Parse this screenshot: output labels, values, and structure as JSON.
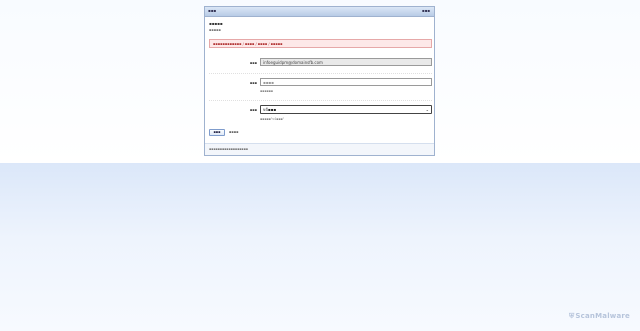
{
  "header": {
    "title": "▪▪▪",
    "right_text": "▪▪▪"
  },
  "form": {
    "heading": "▪▪▪▪▪",
    "subheading": "▪▪▪▪▪",
    "error_message": "▪▪▪▪▪▪▪▪▪▪▪▪ / ▪▪▪▪ / ▪▪▪▪ / ▪▪▪▪▪",
    "email": {
      "label": "▪▪▪",
      "value": "infoeguidpm@domainsfb.com"
    },
    "text_field": {
      "label": "▪▪▪",
      "placeholder": "▪▪▪▪",
      "hint": "▪▪▪▪▪▪"
    },
    "select": {
      "label": "▪▪▪",
      "value": "v4▪▪▪",
      "hint": "▪▪▪▪▪\"v4▪▪▪\""
    },
    "submit_label": "▪▪▪",
    "cancel_label": "▪▪▪▪"
  },
  "footer": {
    "text": "▪▪▪▪▪▪▪▪▪▪▪▪▪▪▪▪▪▪"
  },
  "watermark": {
    "text": "ScanMalware"
  },
  "colors": {
    "header": "#c7d7ef",
    "error_bg": "#fde8e8",
    "error_text": "#b03030",
    "lower_bg": "#dbe7f9"
  }
}
